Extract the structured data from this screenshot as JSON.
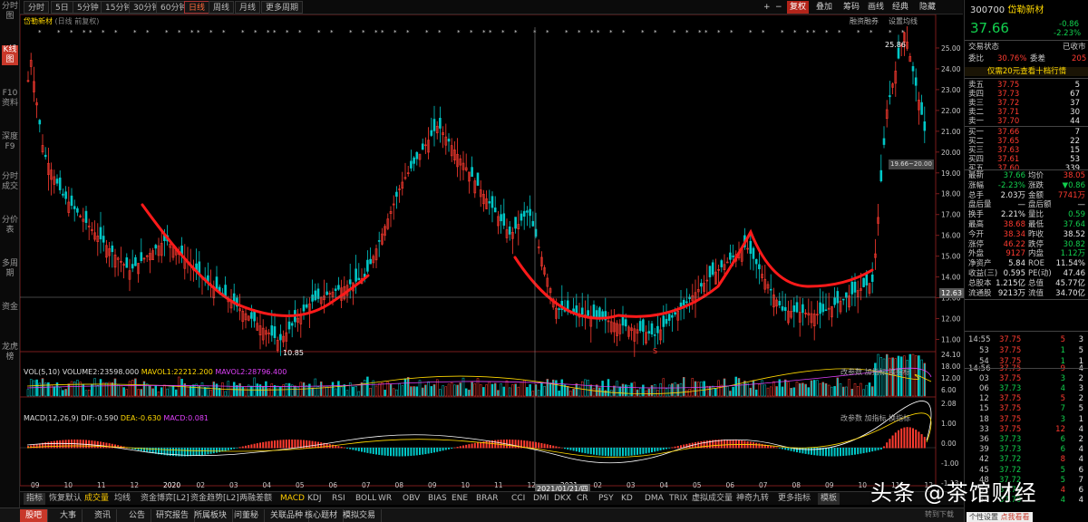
{
  "left_nav": [
    "分时图",
    "K线图",
    "F10资料",
    "深度F9",
    "分时成交",
    "分价表",
    "多周期",
    "资金",
    "龙虎榜"
  ],
  "period_tabs": [
    "分时",
    "5日",
    "5分钟",
    "15分钟",
    "30分钟",
    "60分钟",
    "日线",
    "周线",
    "月线",
    "更多周期"
  ],
  "toolbar_right": {
    "plus": "+",
    "minus": "−",
    "fq": "复权",
    "overlay": "叠加",
    "chip": "筹码",
    "draw": "画线",
    "classic": "经典",
    "hide": "隐藏"
  },
  "stock": {
    "name": "岱勒新材",
    "chart_title_suffix": "(日线 前复权)",
    "code": "300700",
    "price": "37.66",
    "change": "-0.86",
    "pct": "-2.23%",
    "ind": "融资融券",
    "settings": "设置均线"
  },
  "labels": {
    "high": "25.86",
    "low": "10.85",
    "marker_s": "S",
    "cross_date": "2021/01/21/四",
    "price_tag": "12.63",
    "range_tag": "19.66~20.00"
  },
  "price_axis": [
    "25.00",
    "24.00",
    "23.00",
    "22.00",
    "21.00",
    "20.00",
    "19.00",
    "18.00",
    "17.00",
    "16.00",
    "15.00",
    "14.00",
    "13.00",
    "12.00",
    "11.00"
  ],
  "vol": {
    "text": "VOL(5,10)",
    "v": "VOLUME2:23598.000",
    "m1": "MAVOL1:22212.200",
    "m2": "MAVOL2:28796.400",
    "axis": [
      "24.10",
      "18.00",
      "12.00",
      "6.00"
    ],
    "tools": [
      "改参数",
      "加指标",
      "换指标"
    ]
  },
  "macd": {
    "text": "MACD(12,26,9)",
    "dif": "DIF:-0.590",
    "dea": "DEA:-0.630",
    "macd": "MACD:0.081",
    "axis": [
      "2.08",
      "1.00",
      "0.00",
      "-1.00",
      "-1.13"
    ],
    "tools": [
      "改参数",
      "加指标",
      "换指标"
    ]
  },
  "date_axis": [
    "09",
    "10",
    "11",
    "12",
    "2020",
    "02",
    "03",
    "04",
    "05",
    "06",
    "07",
    "08",
    "09",
    "10",
    "11",
    "12",
    "2021",
    "02",
    "03",
    "04",
    "05",
    "06",
    "07",
    "08",
    "09",
    "10",
    "11",
    "12"
  ],
  "indicator_tabs": [
    "指标",
    "恢复默认",
    "成交量",
    "均线",
    "资金博弈[L2]",
    "资金趋势[L2]",
    "两融差额",
    "MACD",
    "KDJ",
    "RSI",
    "BOLL",
    "WR",
    "OBV",
    "BIAS",
    "ENE",
    "BRAR",
    "CCI",
    "DMI",
    "DKX",
    "CR",
    "PSY",
    "KD",
    "DMA",
    "TRIX",
    "虚拟成交量",
    "神奇九转",
    "更多指标",
    "模板"
  ],
  "status_tabs": [
    "股吧",
    "大事",
    "资讯",
    "公告",
    "研究报告",
    "所属板块",
    "问董秘",
    "关联品种",
    "核心题材",
    "模拟交易"
  ],
  "quote": {
    "tradestatus": "交易状态",
    "status_val": "已收市",
    "webi": "委比",
    "webi_val": "30.76%",
    "weicha": "委差",
    "weicha_val": "205",
    "promo": "仅需20元查看十档行情",
    "asks": [
      [
        "卖五",
        "37.75",
        "5"
      ],
      [
        "卖四",
        "37.73",
        "67"
      ],
      [
        "卖三",
        "37.72",
        "37"
      ],
      [
        "卖二",
        "37.71",
        "30"
      ],
      [
        "卖一",
        "37.70",
        "44"
      ]
    ],
    "bids": [
      [
        "买一",
        "37.66",
        "7"
      ],
      [
        "买二",
        "37.65",
        "22"
      ],
      [
        "买三",
        "37.63",
        "15"
      ],
      [
        "买四",
        "37.61",
        "53"
      ],
      [
        "买五",
        "37.60",
        "339"
      ]
    ],
    "stats": [
      [
        "最新",
        "37.66",
        "均价",
        "38.05"
      ],
      [
        "涨幅",
        "-2.23%",
        "涨跌",
        "▼0.86"
      ],
      [
        "总手",
        "2.03万",
        "金额",
        "7741万"
      ],
      [
        "盘后量",
        "—",
        "盘后额",
        "—"
      ],
      [
        "换手",
        "2.21%",
        "量比",
        "0.59"
      ],
      [
        "最高",
        "38.68",
        "最低",
        "37.64"
      ],
      [
        "今开",
        "38.34",
        "昨收",
        "38.52"
      ],
      [
        "涨停",
        "46.22",
        "跌停",
        "30.82"
      ],
      [
        "外盘",
        "9127",
        "内盘",
        "1.12万"
      ],
      [
        "净资产",
        "5.84",
        "ROE",
        "11.54%"
      ],
      [
        "收益(三)",
        "0.595",
        "PE(动)",
        "47.46"
      ],
      [
        "总股本",
        "1.215亿",
        "总值",
        "45.77亿"
      ],
      [
        "流通股",
        "9213万",
        "流值",
        "34.70亿"
      ]
    ],
    "ticks": [
      [
        "14:55",
        "37.75",
        "5",
        "3"
      ],
      [
        "53",
        "37.75",
        "1",
        "5"
      ],
      [
        "54",
        "37.75",
        "1",
        "1"
      ],
      [
        "14:56",
        "37.75",
        "9",
        "4"
      ],
      [
        "03",
        "37.75",
        "3",
        "2"
      ],
      [
        "06",
        "37.73",
        "4",
        "3"
      ],
      [
        "12",
        "37.75",
        "5",
        "2"
      ],
      [
        "15",
        "37.75",
        "7",
        "5"
      ],
      [
        "18",
        "37.75",
        "3",
        "1"
      ],
      [
        "33",
        "37.75",
        "12",
        "4"
      ],
      [
        "36",
        "37.73",
        "6",
        "2"
      ],
      [
        "39",
        "37.73",
        "6",
        "4"
      ],
      [
        "42",
        "37.72",
        "8",
        "4"
      ],
      [
        "45",
        "37.72",
        "5",
        "6"
      ],
      [
        "48",
        "37.72",
        "5",
        "7"
      ],
      [
        "51",
        "37.70",
        "4",
        "6"
      ],
      [
        "54",
        "37.70",
        "4",
        "4"
      ]
    ]
  },
  "watermark": "头条 @茶馆财经",
  "footer_hint": "转到下载",
  "toast": "个性设置",
  "toast_btn": "点我看看",
  "chart_data": {
    "type": "candlestick",
    "title": "岱勒新材 (日线 前复权)",
    "high": 25.86,
    "low": 10.85,
    "last": 12.63,
    "ylim": [
      10.5,
      26.0
    ]
  }
}
